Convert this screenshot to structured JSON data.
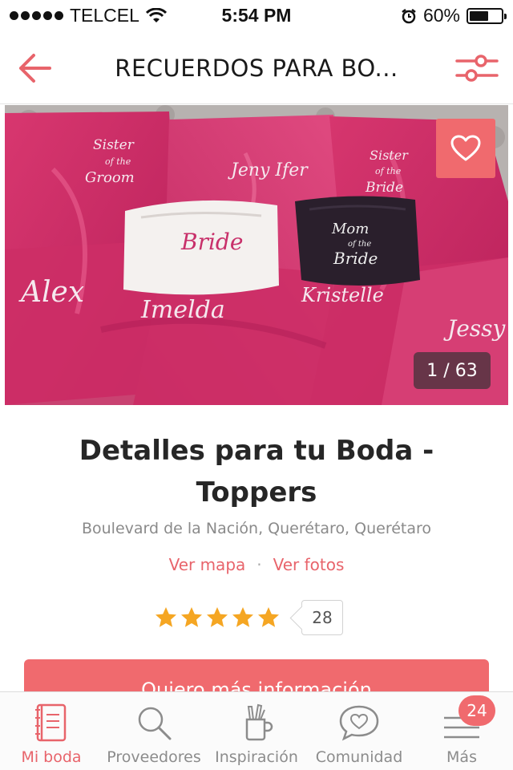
{
  "status_bar": {
    "carrier": "TELCEL",
    "time": "5:54 PM",
    "battery_text": "60%",
    "battery_level": 0.6
  },
  "nav": {
    "title": "RECUERDOS PARA BO...",
    "back_icon": "arrow-left-icon",
    "filter_icon": "sliders-icon"
  },
  "hero": {
    "photo_counter": "1 / 63",
    "heart_icon": "heart-outline-icon",
    "embroidery": {
      "robe1": [
        "Sister",
        "of the",
        "Groom"
      ],
      "robe2": "Jeny Ifer",
      "robe3": [
        "Sister",
        "of the",
        "Bride"
      ],
      "robe_white": "Bride",
      "robe_black": [
        "Mom",
        "of the",
        "Bride"
      ],
      "name1": "Alex",
      "name2": "Imelda",
      "name3": "Kristelle",
      "name4": "Jessy"
    }
  },
  "vendor": {
    "title": "Detalles para tu Boda - Toppers",
    "address": "Boulevard de la Nación, Querétaro, Querétaro",
    "map_link": "Ver mapa",
    "separator": "·",
    "photos_link": "Ver fotos",
    "rating": 5,
    "review_count": "28"
  },
  "cta": {
    "label": "Quiero más información"
  },
  "tabs": [
    {
      "label": "Mi boda",
      "icon": "notebook-icon",
      "active": true
    },
    {
      "label": "Proveedores",
      "icon": "search-icon",
      "active": false
    },
    {
      "label": "Inspiración",
      "icon": "mug-pencils-icon",
      "active": false
    },
    {
      "label": "Comunidad",
      "icon": "chat-heart-icon",
      "active": false
    },
    {
      "label": "Más",
      "icon": "menu-icon",
      "active": false,
      "badge": "24"
    }
  ],
  "colors": {
    "accent": "#f06a6e",
    "link": "#e8646b",
    "star": "#f5a623",
    "robe_pink": "#d0306a"
  }
}
